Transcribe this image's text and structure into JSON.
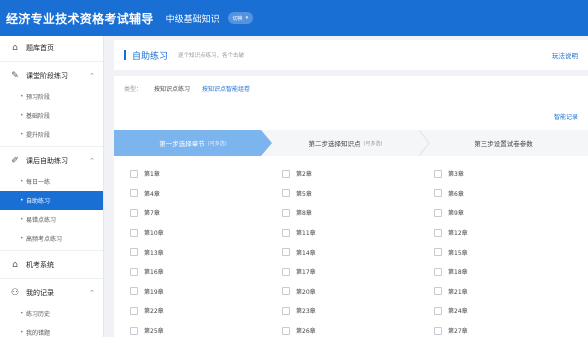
{
  "header": {
    "title": "经济专业技术资格考试辅导",
    "subject": "中级基础知识",
    "switch_label": "切换"
  },
  "sidebar": {
    "groups": [
      {
        "label": "题库首页",
        "icon": "home-icon",
        "items": []
      },
      {
        "label": "课堂阶段练习",
        "icon": "pen-icon",
        "items": [
          "预习阶段",
          "基础阶段",
          "提升阶段"
        ]
      },
      {
        "label": "课后自助练习",
        "icon": "edit-icon",
        "items": [
          "每日一练",
          "自助练习",
          "易错点练习",
          "高频考点练习"
        ],
        "active": "自助练习"
      },
      {
        "label": "机考系统",
        "icon": "house-icon",
        "items": []
      },
      {
        "label": "我的记录",
        "icon": "user-icon",
        "items": [
          "练习历史",
          "我的错题"
        ]
      }
    ]
  },
  "page": {
    "title": "自助练习",
    "desc": "逐个知识点练习，各个击破",
    "help": "玩法说明"
  },
  "typebar": {
    "label": "类型：",
    "options": [
      "按知识点练习",
      "按知识点智能组卷"
    ],
    "selected": "按知识点智能组卷"
  },
  "history_link": "智能记录",
  "steps": [
    {
      "label": "第一步选择章节",
      "hint": "(可多选)"
    },
    {
      "label": "第二步选择知识点",
      "hint": "(可多选)"
    },
    {
      "label": "第三步设置试卷参数",
      "hint": ""
    }
  ],
  "chapters": [
    [
      "第1章",
      "第2章",
      "第3章"
    ],
    [
      "第4章",
      "第5章",
      "第6章"
    ],
    [
      "第7章",
      "第8章",
      "第9章"
    ],
    [
      "第10章",
      "第11章",
      "第12章"
    ],
    [
      "第13章",
      "第14章",
      "第15章"
    ],
    [
      "第16章",
      "第17章",
      "第18章"
    ],
    [
      "第19章",
      "第20章",
      "第21章"
    ],
    [
      "第22章",
      "第23章",
      "第24章"
    ],
    [
      "第25章",
      "第26章",
      "第27章"
    ]
  ],
  "colors": {
    "brand": "#1a6fd4",
    "step_active": "#7cb4ee"
  }
}
